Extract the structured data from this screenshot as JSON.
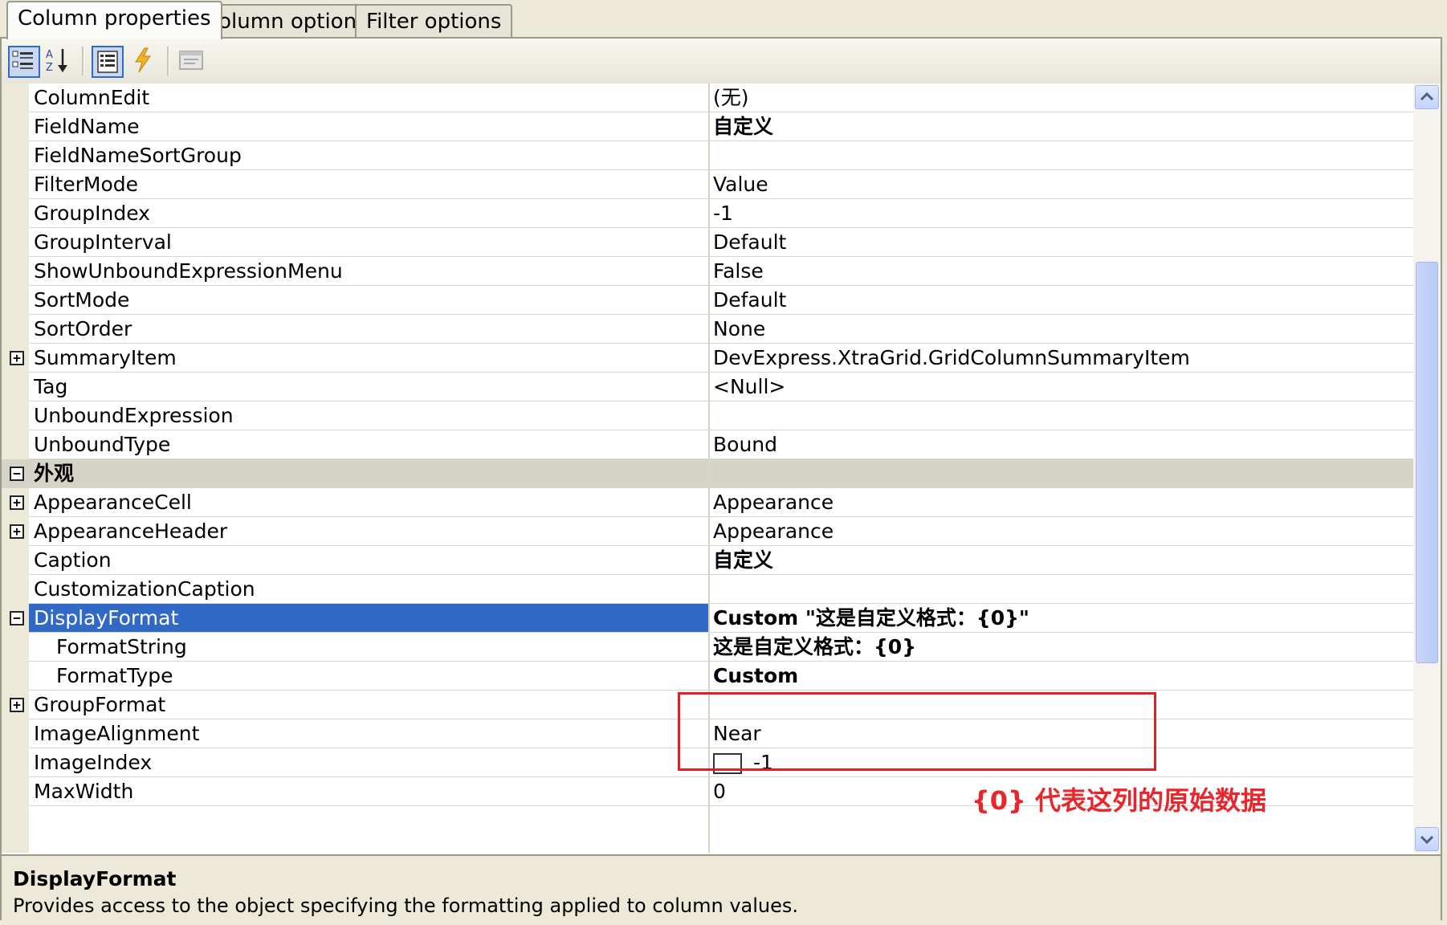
{
  "tabs": [
    {
      "label": "Column properties",
      "active": true
    },
    {
      "label": "Column options",
      "active": false
    },
    {
      "label": "Filter options",
      "active": false
    }
  ],
  "toolbar": {
    "buttons": [
      {
        "icon": "categorized-icon",
        "pressed": true
      },
      {
        "icon": "alphabetical-sort-icon",
        "pressed": false
      },
      {
        "icon": "properties-icon",
        "pressed": true
      },
      {
        "icon": "events-lightning-icon",
        "pressed": false
      },
      {
        "icon": "property-pages-icon",
        "pressed": false
      }
    ]
  },
  "properties": [
    {
      "name": "ColumnEdit",
      "value": "(无)"
    },
    {
      "name": "FieldName",
      "value": "自定义",
      "bold": true
    },
    {
      "name": "FieldNameSortGroup",
      "value": ""
    },
    {
      "name": "FilterMode",
      "value": "Value"
    },
    {
      "name": "GroupIndex",
      "value": "-1"
    },
    {
      "name": "GroupInterval",
      "value": "Default"
    },
    {
      "name": "ShowUnboundExpressionMenu",
      "value": "False"
    },
    {
      "name": "SortMode",
      "value": "Default"
    },
    {
      "name": "SortOrder",
      "value": "None"
    },
    {
      "name": "SummaryItem",
      "value": "DevExpress.XtraGrid.GridColumnSummaryItem",
      "expander": "+"
    },
    {
      "name": "Tag",
      "value": "<Null>"
    },
    {
      "name": "UnboundExpression",
      "value": ""
    },
    {
      "name": "UnboundType",
      "value": "Bound"
    },
    {
      "name": "外观",
      "value": "",
      "category": true,
      "expander": "−"
    },
    {
      "name": "AppearanceCell",
      "value": "Appearance",
      "expander": "+"
    },
    {
      "name": "AppearanceHeader",
      "value": "Appearance",
      "expander": "+"
    },
    {
      "name": "Caption",
      "value": "自定义",
      "bold": true
    },
    {
      "name": "CustomizationCaption",
      "value": ""
    },
    {
      "name": "DisplayFormat",
      "value": "Custom \"这是自定义格式：{0}\"",
      "bold": true,
      "selected": true,
      "expander": "−"
    },
    {
      "name": "FormatString",
      "value": "这是自定义格式：{0}",
      "bold": true,
      "indent": true
    },
    {
      "name": "FormatType",
      "value": "Custom",
      "bold": true,
      "indent": true
    },
    {
      "name": "GroupFormat",
      "value": "",
      "expander": "+"
    },
    {
      "name": "ImageAlignment",
      "value": "Near"
    },
    {
      "name": "ImageIndex",
      "value": "-1",
      "swatch": true
    },
    {
      "name": "MaxWidth",
      "value": "0"
    }
  ],
  "annotation": "{0} 代表这列的原始数据",
  "description": {
    "title": "DisplayFormat",
    "text": "Provides access to the object specifying the formatting applied to column values."
  },
  "colors": {
    "selection": "#3169c6",
    "annotation": "#e8262b",
    "highlight_box": "#e21f26"
  }
}
